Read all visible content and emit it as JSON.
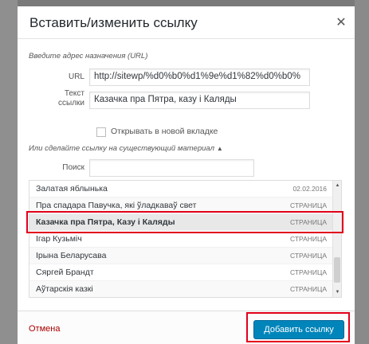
{
  "dialog": {
    "title": "Вставить/изменить ссылку",
    "close_icon": "✕"
  },
  "form": {
    "url_hint": "Введите адрес назначения (URL)",
    "url_label": "URL",
    "url_value": "http://sitewp/%d0%b0%d1%9e%d1%82%d0%b0%",
    "text_label_line1": "Текст",
    "text_label_line2": "ссылки",
    "text_value": "Казачка пра Пятра, казу і Каляды",
    "new_tab_label": "Открывать в новой вкладке",
    "new_tab_checked": false
  },
  "existing": {
    "toggle_label": "Или сделайте ссылку на существующий материал",
    "toggle_icon": "▲",
    "search_label": "Поиск",
    "search_value": ""
  },
  "results": [
    {
      "title": "Залатая яблынька",
      "info": "02.02.2016"
    },
    {
      "title": "Пра спадара Павучка, які ўладкаваў свет",
      "info": "СТРАНИЦА"
    },
    {
      "title": "Казачка пра Пятра, Казу і Каляды",
      "info": "СТРАНИЦА"
    },
    {
      "title": "Ігар Кузьміч",
      "info": "СТРАНИЦА"
    },
    {
      "title": "Ірына Беларусава",
      "info": "СТРАНИЦА"
    },
    {
      "title": "Сяргей Брандт",
      "info": "СТРАНИЦА"
    },
    {
      "title": "Аўтарскія казкі",
      "info": "СТРАНИЦА"
    }
  ],
  "footer": {
    "cancel_label": "Отмена",
    "submit_label": "Добавить ссылку"
  },
  "colors": {
    "accent": "#0085ba",
    "cancel": "#aa0000",
    "highlight": "#e2001a",
    "backdrop": "#7a7a7a"
  }
}
